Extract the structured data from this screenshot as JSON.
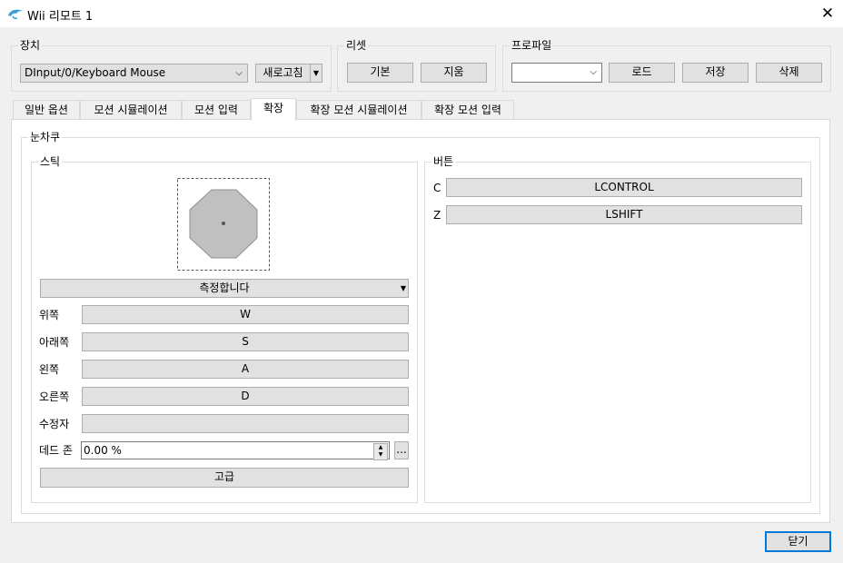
{
  "window": {
    "title": "Wii 리모트 1",
    "close_glyph": "✕",
    "accent_color": "#3aa0d8"
  },
  "device": {
    "group_label": "장치",
    "selected": "DInput/0/Keyboard Mouse",
    "refresh_label": "새로고침"
  },
  "reset": {
    "group_label": "리셋",
    "default_label": "기본",
    "clear_label": "지움"
  },
  "profile": {
    "group_label": "프로파일",
    "selected": "",
    "load_label": "로드",
    "save_label": "저장",
    "delete_label": "삭제"
  },
  "tabs": [
    {
      "label": "일반 옵션"
    },
    {
      "label": "모션 시뮬레이션"
    },
    {
      "label": "모션 입력"
    },
    {
      "label": "확장",
      "active": true
    },
    {
      "label": "확장 모션 시뮬레이션"
    },
    {
      "label": "확장 모션 입력"
    }
  ],
  "extension": {
    "group_label": "눈차쿠",
    "stick": {
      "group_label": "스틱",
      "mode_selected": "측정합니다",
      "rows": [
        {
          "label": "위쪽",
          "value": "W"
        },
        {
          "label": "아래쪽",
          "value": "S"
        },
        {
          "label": "왼쪽",
          "value": "A"
        },
        {
          "label": "오른쪽",
          "value": "D"
        },
        {
          "label": "수정자",
          "value": ""
        }
      ],
      "dead_zone": {
        "label": "데드 존",
        "value": "0.00 %",
        "more_label": "..."
      },
      "advanced_label": "고급"
    },
    "buttons": {
      "group_label": "버튼",
      "rows": [
        {
          "label": "C",
          "value": "LCONTROL"
        },
        {
          "label": "Z",
          "value": "LSHIFT"
        }
      ]
    }
  },
  "footer": {
    "close_label": "닫기"
  }
}
